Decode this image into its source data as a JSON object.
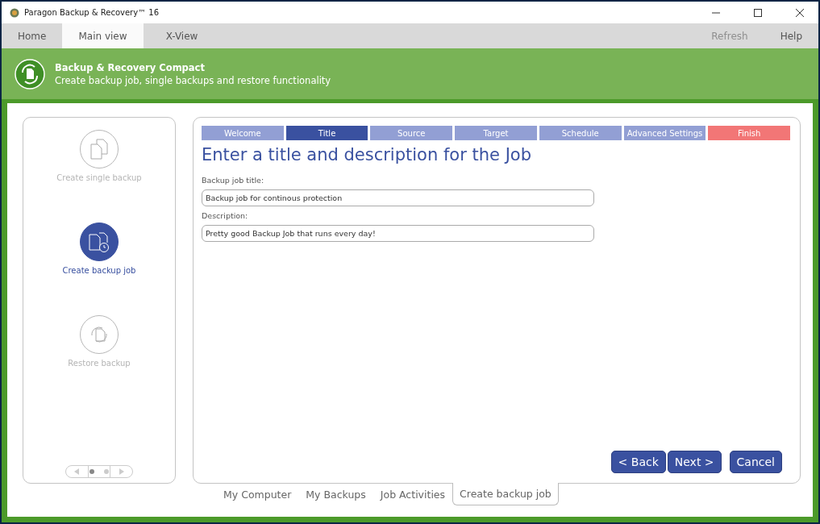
{
  "window": {
    "title": "Paragon Backup & Recovery™ 16"
  },
  "menu_tabs": [
    {
      "label": "Home",
      "selected": false
    },
    {
      "label": "Main view",
      "selected": true
    },
    {
      "label": "X-View",
      "selected": false
    }
  ],
  "menu_actions": [
    {
      "label": "Refresh",
      "disabled": true
    },
    {
      "label": "Help",
      "disabled": false
    }
  ],
  "header": {
    "title": "Backup & Recovery Compact",
    "subtitle": "Create backup job, single backups and restore functionality"
  },
  "sidebar": {
    "items": [
      {
        "label": "Create single backup",
        "kind": "single",
        "selected": false
      },
      {
        "label": "Create backup job",
        "kind": "job",
        "selected": true
      },
      {
        "label": "Restore backup",
        "kind": "restore",
        "selected": false
      }
    ],
    "pager": [
      {
        "selected": true
      },
      {
        "selected": false
      }
    ]
  },
  "wizard": {
    "steps": [
      {
        "label": "Welcome",
        "kind": "step",
        "selected": false
      },
      {
        "label": "Title",
        "kind": "step",
        "selected": true
      },
      {
        "label": "Source",
        "kind": "step",
        "selected": false
      },
      {
        "label": "Target",
        "kind": "step",
        "selected": false
      },
      {
        "label": "Schedule",
        "kind": "step",
        "selected": false
      },
      {
        "label": "Advanced Settings",
        "kind": "step",
        "selected": false
      },
      {
        "label": "Finish",
        "kind": "finish",
        "selected": false
      }
    ],
    "heading": "Enter a title and description for the Job",
    "fields": [
      {
        "label": "Backup job title:",
        "value": "Backup job for continous protection"
      },
      {
        "label": "Description:",
        "value": "Pretty good Backup Job that runs every day!"
      }
    ],
    "buttons": [
      "< Back",
      "Next >",
      "Cancel"
    ]
  },
  "bottom_tabs": [
    {
      "label": "My Computer",
      "selected": false
    },
    {
      "label": "My Backups",
      "selected": false
    },
    {
      "label": "Job Activities",
      "selected": false
    },
    {
      "label": "Create backup job",
      "selected": true
    }
  ]
}
